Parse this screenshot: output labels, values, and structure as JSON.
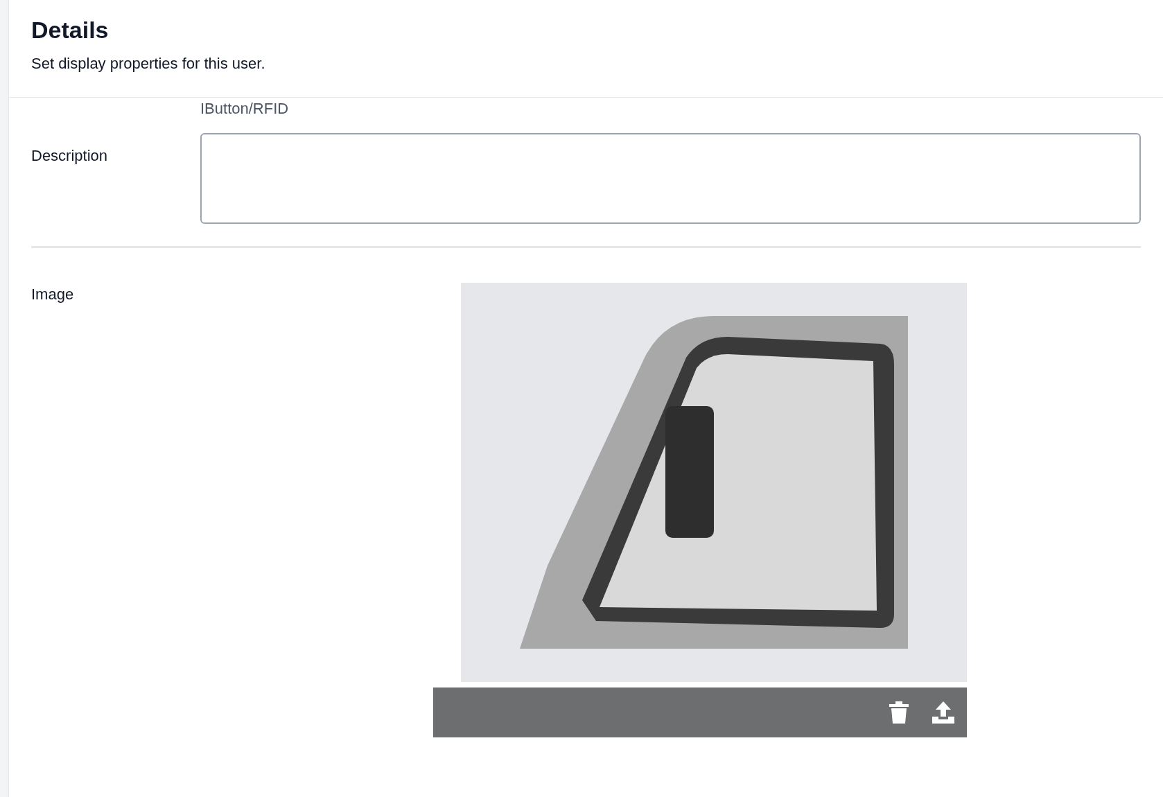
{
  "header": {
    "title": "Details",
    "subtitle": "Set display properties for this user."
  },
  "fields": [
    {
      "kind": "text",
      "value": "IButton/RFID"
    },
    {
      "kind": "textarea",
      "label": "Description"
    }
  ],
  "image_field": {
    "label": "Image"
  }
}
